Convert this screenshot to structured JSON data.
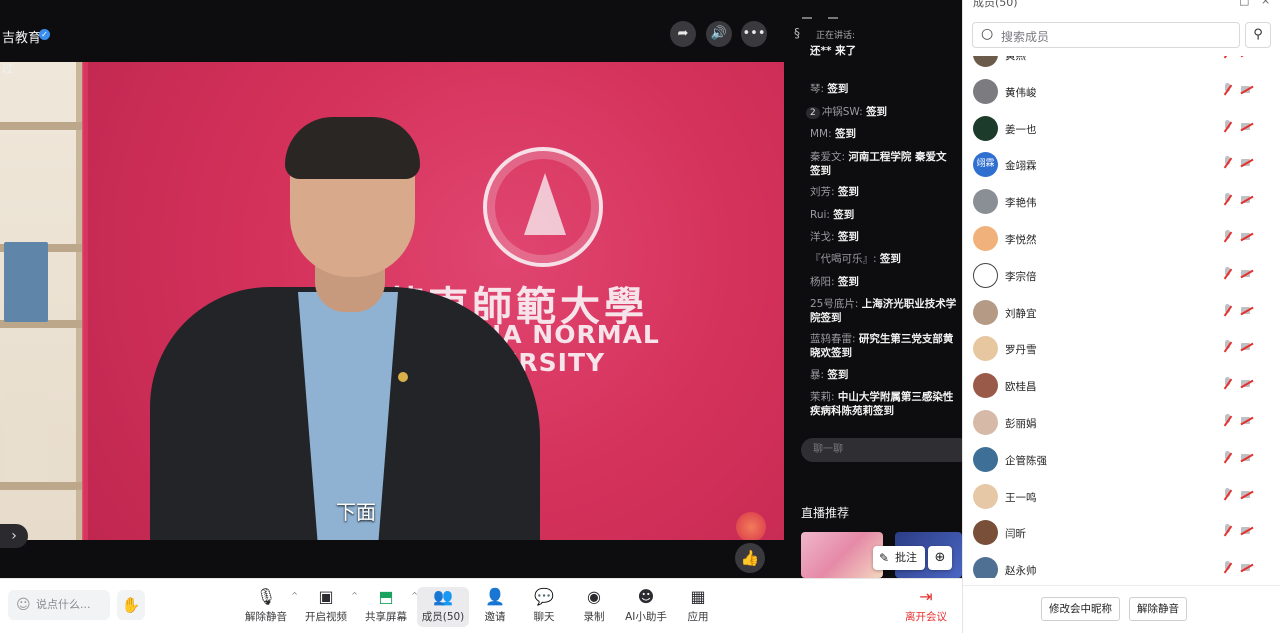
{
  "stream": {
    "host_name": "吉教育",
    "top_left_label": "过",
    "subtitle": "下面",
    "university_cn": "華東師範大學",
    "university_en_1": "INA NORMAL",
    "university_en_2": "VERSITY",
    "controls": {
      "share_icon": "share-arrow-icon",
      "volume_icon": "volume-icon",
      "more_icon": "more-dots-icon"
    }
  },
  "chat": {
    "speaking_label": "正在讲话:",
    "messages": [
      {
        "who": "还** 来了",
        "what": ""
      },
      {
        "who": "琴:",
        "what": "签到"
      },
      {
        "badge": "2",
        "who": "冲锅SW:",
        "what": "签到"
      },
      {
        "who": "MM:",
        "what": "签到"
      },
      {
        "who": "秦爱文:",
        "what": "河南工程学院 秦爱文 签到"
      },
      {
        "who": "刘芳:",
        "what": "签到"
      },
      {
        "who": "Rui:",
        "what": "签到"
      },
      {
        "who": "洋戈:",
        "what": "签到"
      },
      {
        "who": "『代喝可乐』:",
        "what": "签到"
      },
      {
        "who": "杨阳:",
        "what": "签到"
      },
      {
        "who": "25号底片:",
        "what": "上海济光职业技术学院签到"
      },
      {
        "who": "蓝鸫春雷:",
        "what": "研究生第三党支部黄晓欢签到"
      },
      {
        "who": "暴:",
        "what": "签到"
      },
      {
        "who": "茉莉:",
        "what": "中山大学附属第三感染性疾病科陈苑莉签到"
      }
    ],
    "input_placeholder": "聊一聊",
    "live_recommend_title": "直播推荐",
    "annotate_label": "批注"
  },
  "toolbar": {
    "say_placeholder": "说点什么...",
    "items": [
      {
        "label": "解除静音",
        "icon": "mic-off-icon"
      },
      {
        "label": "开启视频",
        "icon": "camera-off-icon"
      },
      {
        "label": "共享屏幕",
        "icon": "share-screen-icon"
      },
      {
        "label": "成员(50)",
        "icon": "members-icon"
      },
      {
        "label": "邀请",
        "icon": "invite-icon"
      },
      {
        "label": "聊天",
        "icon": "chat-icon"
      },
      {
        "label": "录制",
        "icon": "record-icon"
      },
      {
        "label": "AI小助手",
        "icon": "ai-assistant-icon"
      },
      {
        "label": "应用",
        "icon": "apps-icon"
      }
    ],
    "leave_label": "离开会议",
    "leave_color": "#e5322e"
  },
  "members": {
    "panel_title_cut": "成员(50)",
    "search_placeholder": "搜索成员",
    "list": [
      {
        "name": "黄燕",
        "avatar_color": "#6b5b4b",
        "avatar_text": ""
      },
      {
        "name": "黄伟峻",
        "avatar_color": "#7b7b80",
        "avatar_text": ""
      },
      {
        "name": "姜一也",
        "avatar_color": "#1d3b2a",
        "avatar_text": ""
      },
      {
        "name": "金翊霖",
        "avatar_color": "#2f6fd0",
        "avatar_text": "翊霖"
      },
      {
        "name": "李艳伟",
        "avatar_color": "#8a8f96",
        "avatar_text": ""
      },
      {
        "name": "李悦然",
        "avatar_color": "#f0b27a",
        "avatar_text": ""
      },
      {
        "name": "李宗倍",
        "avatar_color": "#ffffff",
        "avatar_text": ""
      },
      {
        "name": "刘静宜",
        "avatar_color": "#b59a86",
        "avatar_text": ""
      },
      {
        "name": "罗丹雪",
        "avatar_color": "#e7c7a0",
        "avatar_text": ""
      },
      {
        "name": "欧桂昌",
        "avatar_color": "#9a5a4a",
        "avatar_text": ""
      },
      {
        "name": "彭丽娟",
        "avatar_color": "#d7b9a8",
        "avatar_text": ""
      },
      {
        "name": "企管陈强",
        "avatar_color": "#3e6f96",
        "avatar_text": ""
      },
      {
        "name": "王一鸣",
        "avatar_color": "#e6c8a6",
        "avatar_text": ""
      },
      {
        "name": "闫昕",
        "avatar_color": "#7a4f3a",
        "avatar_text": ""
      },
      {
        "name": "赵永帅",
        "avatar_color": "#4f6f93",
        "avatar_text": ""
      }
    ],
    "rename_button": "修改会中昵称",
    "unmute_button": "解除静音"
  }
}
